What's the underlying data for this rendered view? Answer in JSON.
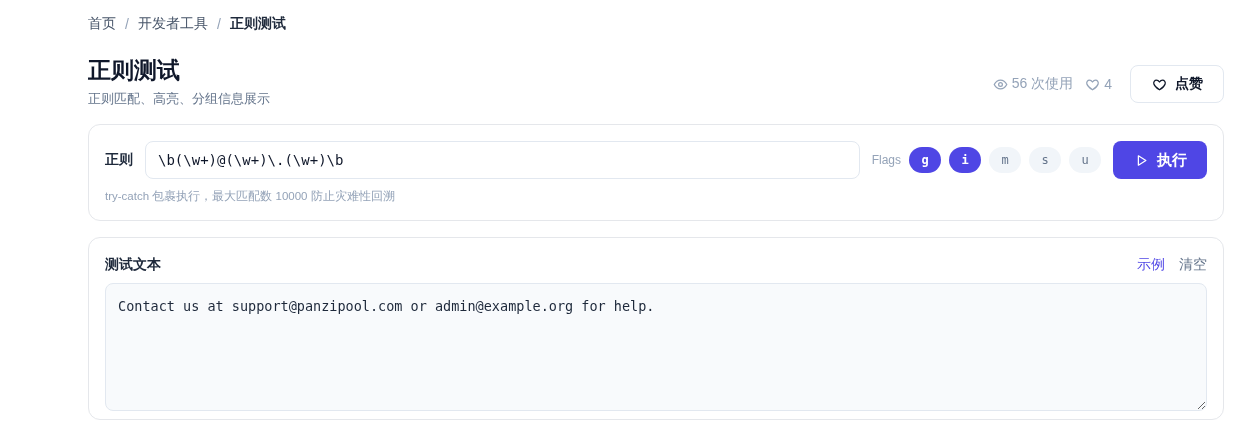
{
  "breadcrumb": [
    {
      "label": "首页",
      "current": false
    },
    {
      "label": "开发者工具",
      "current": false
    },
    {
      "label": "正则测试",
      "current": true
    }
  ],
  "breadcrumb_separator": "/",
  "header": {
    "title": "正则测试",
    "subtitle": "正则匹配、高亮、分组信息展示",
    "views": "56 次使用",
    "likes": "4",
    "like_button": "点赞"
  },
  "regex_panel": {
    "label": "正则",
    "pattern": "\\b(\\w+)@(\\w+)\\.(\\w+)\\b",
    "flags_label": "Flags",
    "flags": [
      {
        "label": "g",
        "selected": true
      },
      {
        "label": "i",
        "selected": true
      },
      {
        "label": "m",
        "selected": false
      },
      {
        "label": "s",
        "selected": false
      },
      {
        "label": "u",
        "selected": false
      }
    ],
    "run_button": "执行",
    "hint": "try-catch 包裹执行，最大匹配数 10000 防止灾难性回溯"
  },
  "text_panel": {
    "title": "测试文本",
    "actions": [
      {
        "label": "示例",
        "kind": "primary"
      },
      {
        "label": "清空",
        "kind": "plain"
      }
    ],
    "value": "Contact us at support@panzipool.com or admin@example.org for help."
  }
}
